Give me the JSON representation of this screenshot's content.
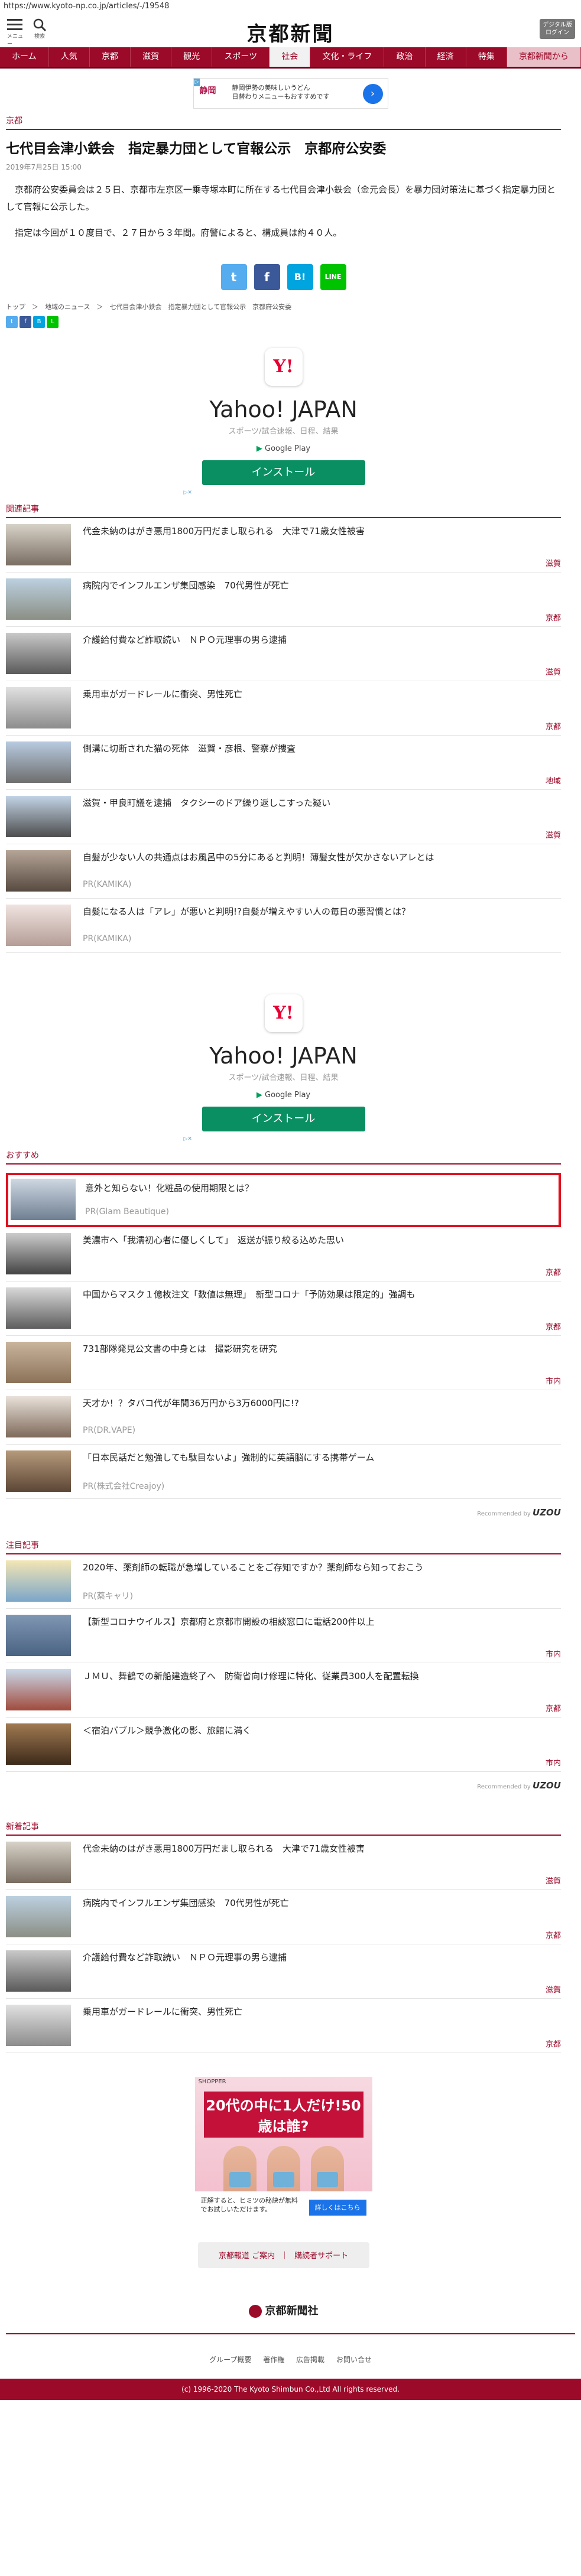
{
  "url": "https://www.kyoto-np.co.jp/articles/-/19548",
  "header": {
    "menu_label": "メニュー",
    "search_label": "検索",
    "logo": "京都新聞",
    "digital_line1": "デジタル版",
    "digital_line2": "ログイン"
  },
  "nav": [
    "ホーム",
    "人気",
    "京都",
    "滋賀",
    "観光",
    "スポーツ",
    "社会",
    "文化・ライフ",
    "政治",
    "経済",
    "特集",
    "京都新聞から"
  ],
  "top_ad": {
    "logo": "静岡",
    "text1": "静岡伊勢の美味しいうどん",
    "text2": "日替わりメニューもおすすめです"
  },
  "article": {
    "section": "京都",
    "title": "七代目会津小鉄会　指定暴力団として官報公示　京都府公安委",
    "date": "2019年7月25日 15:00",
    "para1": "京都府公安委員会は２５日、京都市左京区一乗寺塚本町に所在する七代目会津小鉄会（金元会長）を暴力団対策法に基づく指定暴力団として官報に公示した。",
    "para2": "指定は今回が１０度目で、２７日から３年間。府警によると、構成員は約４０人。"
  },
  "share": {
    "twitter": "t",
    "facebook": "f",
    "hatena": "B!",
    "line": "LINE"
  },
  "breadcrumb": "トップ　＞　地域のニュース　＞　七代目会津小鉄会　指定暴力団として官報公示　京都府公安委",
  "yahoo_ad": {
    "icon": "Y!",
    "title": "Yahoo! JAPAN",
    "sub": "スポーツ/試合速報、日程、結果",
    "store": "Google Play",
    "install": "インストール"
  },
  "related": {
    "heading": "関連記事",
    "items": [
      {
        "title": "代金未納のはがき悪用1800万円だまし取られる　大津で71歳女性被害",
        "cat": "滋賀"
      },
      {
        "title": "病院内でインフルエンザ集団感染　70代男性が死亡",
        "cat": "京都"
      },
      {
        "title": "介護給付費など詐取続い　ＮＰＯ元理事の男ら逮捕",
        "cat": "滋賀"
      },
      {
        "title": "乗用車がガードレールに衝突、男性死亡",
        "cat": "京都"
      },
      {
        "title": "側溝に切断された猫の死体　滋賀・彦根、警察が捜査",
        "cat": "地域"
      },
      {
        "title": "滋賀・甲良町議を逮捕　タクシーのドア繰り返しこすった疑い",
        "cat": "滋賀"
      }
    ],
    "pr_items": [
      {
        "title": "自髪が少ない人の共通点はお風呂中の5分にあると判明！薄髪女性が欠かさないアレとは",
        "pr": "PR(KAMIKA)"
      },
      {
        "title": "自髪になる人は「アレ」が悪いと判明!?自髪が増えやすい人の毎日の悪習慣とは？",
        "pr": "PR(KAMIKA)"
      }
    ]
  },
  "recommend": {
    "heading": "おすすめ",
    "items": [
      {
        "title": "意外と知らない！化粧品の使用期限とは？",
        "cat": "",
        "pr": "PR(Glam Beautique)"
      },
      {
        "title": "美濃市へ「我濡初心者に優しくして」　返送が振り絞る込めた思い",
        "cat": "京都",
        "pr": ""
      },
      {
        "title": "中国からマスク１億枚注文「数値は無理」　新型コロナ「予防効果は限定的」強調も",
        "cat": "京都",
        "pr": ""
      },
      {
        "title": "731部隊発見公文書の中身とは　撮影研究を研究",
        "cat": "市内",
        "pr": ""
      },
      {
        "title": "天才か！？タバコ代が年間36万円から3万6000円に!?",
        "cat": "",
        "pr": "PR(DR.VAPE)"
      },
      {
        "title": "「日本民話だと勉強しても駄目ないよ」強制的に英語脳にする携帯ゲーム",
        "cat": "",
        "pr": "PR(株式会社Creajoy)"
      }
    ],
    "by": "Recommended by",
    "brand": "UZOU"
  },
  "attention": {
    "heading": "注目記事",
    "items": [
      {
        "title": "2020年、薬剤師の転職が急増していることをご存知ですか？薬剤師なら知っておこう",
        "cat": "",
        "pr": "PR(薬キャリ)"
      },
      {
        "title": "【新型コロナウイルス】京都府と京都市開設の相談窓口に電話200件以上",
        "cat": "市内",
        "pr": ""
      },
      {
        "title": "ＪＭＵ、舞鶴での新船建造終了へ　防衛省向け修理に特化、従業員300人を配置転換",
        "cat": "京都",
        "pr": ""
      },
      {
        "title": "＜宿泊バブル＞競争激化の影、旅館に満く",
        "cat": "市内",
        "pr": ""
      }
    ],
    "by": "Recommended by",
    "brand": "UZOU"
  },
  "latest": {
    "heading": "新着記事",
    "items": [
      {
        "title": "代金未納のはがき悪用1800万円だまし取られる　大津で71歳女性被害",
        "cat": "滋賀"
      },
      {
        "title": "病院内でインフルエンザ集団感染　70代男性が死亡",
        "cat": "京都"
      },
      {
        "title": "介護給付費など詐取続い　ＮＰＯ元理事の男ら逮捕",
        "cat": "滋賀"
      },
      {
        "title": "乗用車がガードレールに衝突、男性死亡",
        "cat": "京都"
      }
    ]
  },
  "bottom_ad": {
    "brand": "SHOPPER",
    "headline": "20代の中に1人だけ!50歳は誰?",
    "foot_text": "正解すると、ヒミツの秘訣が無料でお試しいただけます。",
    "button": "詳しくはこちら"
  },
  "footer": {
    "link1": "京都報道 ご案内",
    "sep": "｜",
    "link2": "購読者サポート",
    "logo": "京都新聞社",
    "nav": [
      "グループ概要",
      "著作権",
      "広告掲載",
      "お問い合せ"
    ],
    "copyright": "(c) 1996-2020 The Kyoto Shimbun Co.,Ltd All rights reserved."
  },
  "colors": {
    "brand": "#9c0a29",
    "highlight": "#e01020"
  }
}
